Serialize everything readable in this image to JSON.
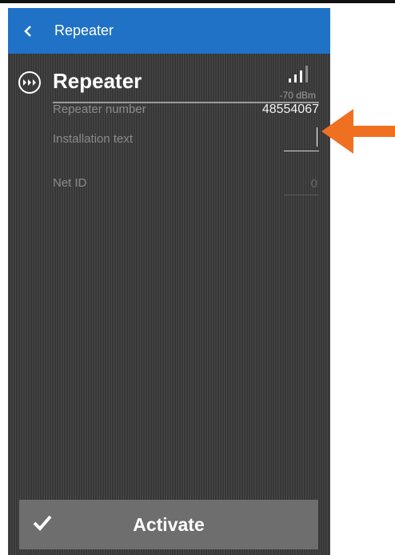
{
  "app_bar": {
    "title": "Repeater",
    "back_icon": "chevron-left-icon",
    "color": "#1f72c6"
  },
  "device": {
    "icon": "repeater-icon",
    "title": "Repeater",
    "signal": {
      "icon": "signal-strength-icon",
      "text": "-70 dBm",
      "level_fraction": 0.75
    }
  },
  "fields": {
    "repeater_number": {
      "label": "Repeater number",
      "value": "48554067"
    },
    "installation_text": {
      "label": "Installation text",
      "value": ""
    },
    "net_id": {
      "label": "Net ID",
      "value": "0"
    }
  },
  "activate_button": {
    "label": "Activate",
    "icon": "checkmark-icon",
    "color": "#6e6e6e"
  },
  "annotation": {
    "icon": "pointer-arrow-icon",
    "color": "#f07021"
  }
}
